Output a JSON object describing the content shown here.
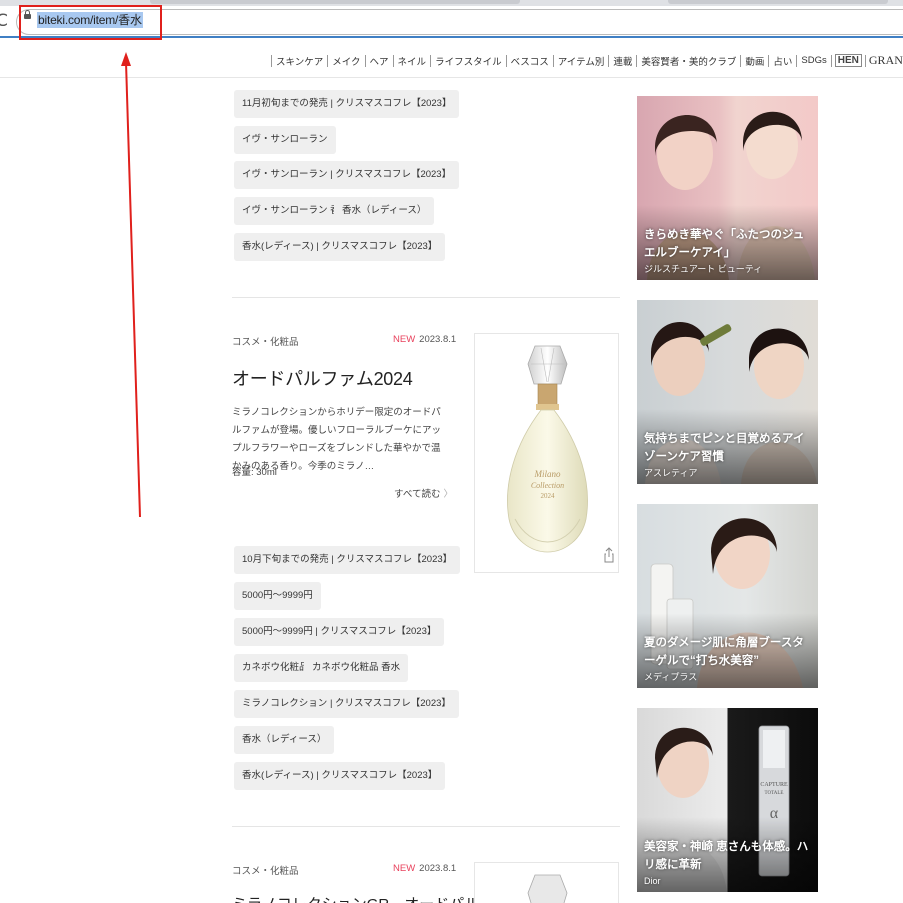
{
  "browser": {
    "url": "biteki.com/item/香水",
    "reload_glyph": "C"
  },
  "nav": {
    "items": [
      "スキンケア",
      "メイク",
      "ヘア",
      "ネイル",
      "ライフスタイル",
      "ベスコス",
      "アイテム別",
      "連載",
      "美容賢者・美的クラブ",
      "動画",
      "占い",
      "SDGs"
    ],
    "hen": "HEN",
    "grand": "GRAND"
  },
  "article0": {
    "tags": [
      "11月初旬までの発売 | クリスマスコフレ【2023】",
      "イヴ・サンローラン",
      "イヴ・サンローラン | クリスマスコフレ【2023】",
      "イヴ・サンローラン 香水",
      "香水（レディース）",
      "香水(レディース) | クリスマスコフレ【2023】"
    ]
  },
  "article1": {
    "category": "コスメ・化粧品",
    "new_badge": "NEW",
    "date": "2023.8.1",
    "title": "オードパルファム2024",
    "excerpt": "ミラノコレクションからホリデー限定のオードパルファムが登場。優しいフローラルブーケにアップルフラワーやローズをブレンドした華やかで温かみのある香り。今季のミラノ…",
    "volume": "容量: 30ml",
    "read_more": "すべて読む",
    "tags": [
      "10月下旬までの発売 | クリスマスコフレ【2023】",
      "5000円～9999円",
      "5000円～9999円 | クリスマスコフレ【2023】",
      "カネボウ化粧品",
      "カネボウ化粧品 香水",
      "ミラノコレクション | クリスマスコフレ【2023】",
      "香水（レディース）",
      "香水(レディース) | クリスマスコフレ【2023】"
    ]
  },
  "article2": {
    "category": "コスメ・化粧品",
    "new_badge": "NEW",
    "date": "2023.8.1",
    "title": "ミラノコレクションGR　オードパル"
  },
  "ads": [
    {
      "headline": "きらめき華やぐ「ふたつのジュエルブーケアイ」",
      "brand": "ジルスチュアート ビューティ"
    },
    {
      "headline": "気持ちまでピンと目覚めるアイゾーンケア習慣",
      "brand": "アスレティア"
    },
    {
      "headline": "夏のダメージ肌に角層ブースターゲルで“打ち水美容”",
      "brand": "メディプラス"
    },
    {
      "headline": "美容家・神崎 恵さんも体感。ハリ感に革新",
      "brand": "Dior"
    }
  ],
  "colors": {
    "annotation_red": "#e0201c",
    "url_highlight": "#a8c8f0",
    "new_badge": "#e8415c",
    "tag_bg": "#efefef"
  }
}
